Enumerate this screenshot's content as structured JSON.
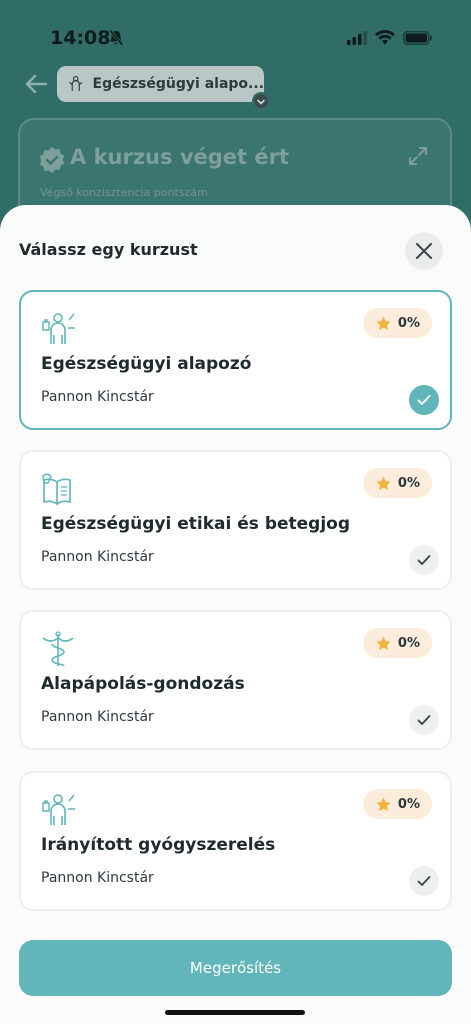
{
  "status_bar": {
    "time": "14:08"
  },
  "header": {
    "course_chip_label": "Egészségügyi alapo..."
  },
  "background_card": {
    "title": "A kurzus véget ért",
    "subtitle": "Végső konzisztencia pontszám"
  },
  "sheet": {
    "title": "Válassz egy kurzust",
    "courses": [
      {
        "name": "Egészségügyi alapozó",
        "provider": "Pannon Kincstár",
        "score": "0%",
        "selected": true,
        "icon": "healthcare-worker-icon"
      },
      {
        "name": "Egészségügyi etikai és betegjog",
        "provider": "Pannon Kincstár",
        "score": "0%",
        "selected": false,
        "icon": "book-icon"
      },
      {
        "name": "Alapápolás-gondozás",
        "provider": "Pannon Kincstár",
        "score": "0%",
        "selected": false,
        "icon": "caduceus-icon"
      },
      {
        "name": "Irányított gyógyszerelés",
        "provider": "Pannon Kincstár",
        "score": "0%",
        "selected": false,
        "icon": "healthcare-worker-icon"
      }
    ],
    "confirm_label": "Megerősítés"
  },
  "colors": {
    "accent": "#5fb5b8",
    "badge_bg": "#fbecdb",
    "star": "#f2b33d"
  }
}
